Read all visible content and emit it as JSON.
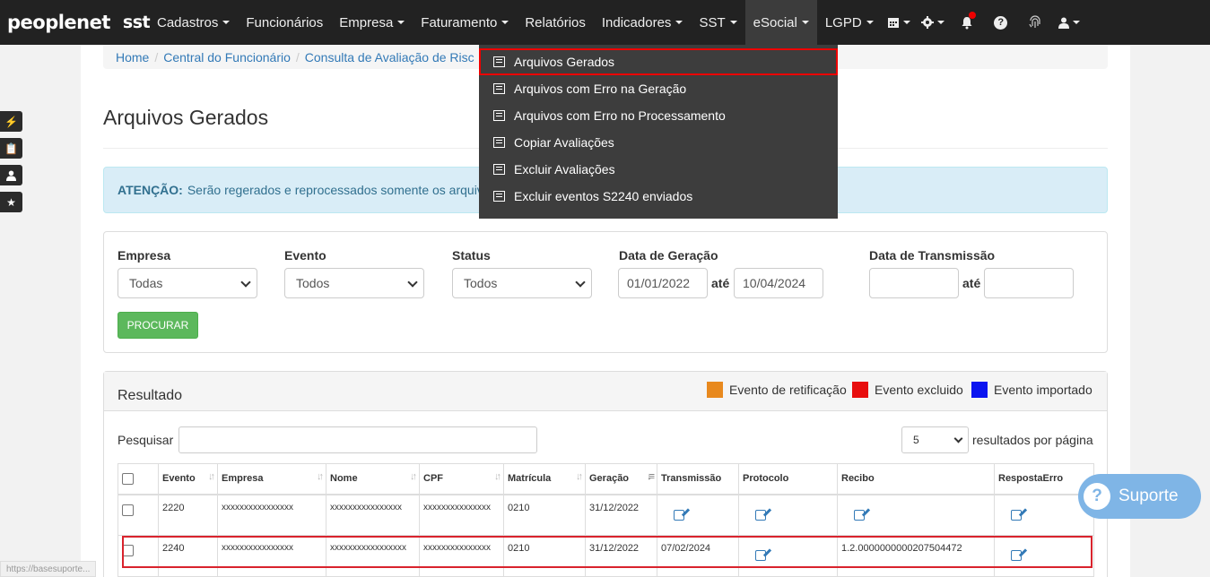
{
  "brand": {
    "name": "peoplenet",
    "product": "sst"
  },
  "nav": {
    "items": [
      {
        "label": "Cadastros",
        "caret": true
      },
      {
        "label": "Funcionários",
        "caret": false
      },
      {
        "label": "Empresa",
        "caret": true
      },
      {
        "label": "Faturamento",
        "caret": true
      },
      {
        "label": "Relatórios",
        "caret": false
      },
      {
        "label": "Indicadores",
        "caret": true
      },
      {
        "label": "SST",
        "caret": true
      },
      {
        "label": "eSocial",
        "caret": true,
        "active": true
      },
      {
        "label": "LGPD",
        "caret": true
      }
    ],
    "icons": [
      "calendar-icon",
      "gear-icon",
      "bell-icon",
      "help-icon",
      "fingerprint-icon",
      "user-icon"
    ]
  },
  "dropdown": {
    "items": [
      "Arquivos Gerados",
      "Arquivos com Erro na Geração",
      "Arquivos com Erro no Processamento",
      "Copiar Avaliações",
      "Excluir Avaliações",
      "Excluir eventos S2240 enviados"
    ],
    "highlighted_index": 0
  },
  "breadcrumb": [
    "Home",
    "Central do Funcionário",
    "Consulta de Avaliação de Risc"
  ],
  "page_title": "Arquivos Gerados",
  "alert": {
    "strong": "ATENÇÃO:",
    "text": "Serão regerados e reprocessados somente os arquiv"
  },
  "filters": {
    "empresa": {
      "label": "Empresa",
      "value": "Todas"
    },
    "evento": {
      "label": "Evento",
      "value": "Todos"
    },
    "status": {
      "label": "Status",
      "value": "Todos"
    },
    "data_geracao": {
      "label": "Data de Geração",
      "from": "01/01/2022",
      "to_label": "até",
      "to": "10/04/2024"
    },
    "data_transmissao": {
      "label": "Data de Transmissão",
      "from": "",
      "to_label": "até",
      "to": ""
    },
    "search_button": "PROCURAR"
  },
  "results": {
    "title": "Resultado",
    "legend": [
      {
        "label": "Evento de retificação",
        "color": "#e8891e"
      },
      {
        "label": "Evento excluido",
        "color": "#e80e0e"
      },
      {
        "label": "Evento importado",
        "color": "#0a14f0"
      }
    ],
    "search_label": "Pesquisar",
    "search_value": "",
    "per_page_value": "5",
    "per_page_label": "resultados por página",
    "columns": [
      "Evento",
      "Empresa",
      "Nome",
      "CPF",
      "Matrícula",
      "Geração",
      "Transmissão",
      "Protocolo",
      "Recibo",
      "RespostaErro"
    ],
    "rows": [
      {
        "evento": "2220",
        "empresa": "xxxxxxxxxxxxxxxx",
        "nome": "xxxxxxxxxxxxxxxx",
        "cpf": "xxxxxxxxxxxxxxx",
        "matricula": "0210",
        "geracao": "31/12/2022",
        "transmissao": "",
        "recibo": ""
      },
      {
        "evento": "2240",
        "empresa": "xxxxxxxxxxxxxxxx",
        "nome": "xxxxxxxxxxxxxxxxx",
        "cpf": "xxxxxxxxxxxxxxx",
        "matricula": "0210",
        "geracao": "31/12/2022",
        "transmissao": "07/02/2024",
        "recibo": "1.2.0000000000207504472"
      }
    ]
  },
  "support_button": "Suporte",
  "status_url": "https://basesuporte..."
}
